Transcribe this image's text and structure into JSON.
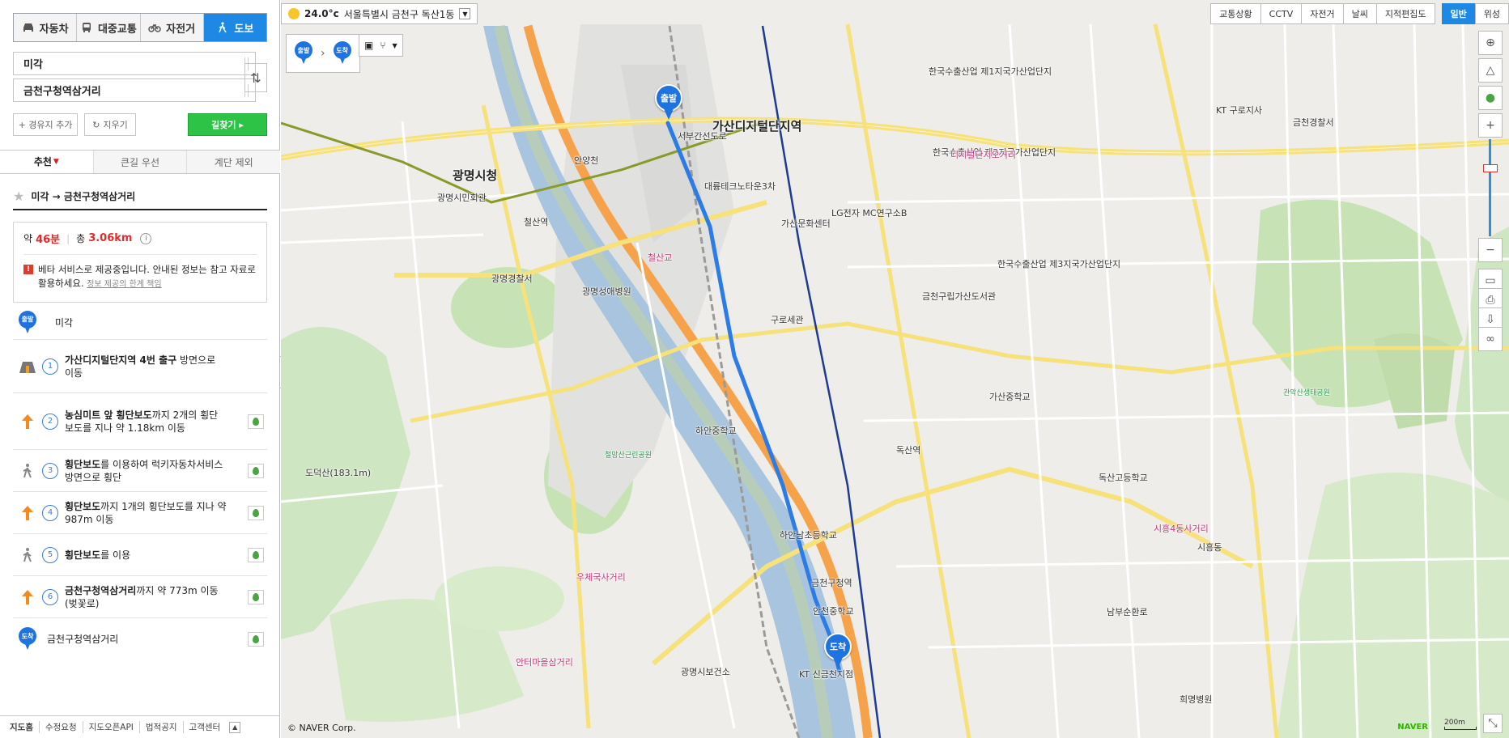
{
  "modes": [
    {
      "label": "자동차",
      "active": false
    },
    {
      "label": "대중교통",
      "active": false
    },
    {
      "label": "자전거",
      "active": false
    },
    {
      "label": "도보",
      "active": true
    }
  ],
  "origin_value": "미각",
  "destination_value": "금천구청역삼거리",
  "add_waypoint_label": "+ 경유지 추가",
  "clear_label": "지우기",
  "search_route_label": "길찾기 ▸",
  "tabs": [
    {
      "label": "추천",
      "active": true
    },
    {
      "label": "큰길 우선",
      "active": false
    },
    {
      "label": "계단 제외",
      "active": false
    }
  ],
  "route_title": "미각 → 금천구청역삼거리",
  "summary": {
    "approx": "약",
    "time": "46분",
    "total": "총",
    "distance": "3.06km",
    "info_icon": "i",
    "warning_icon": "!",
    "notice": "베타 서비스로 제공중입니다. 안내된 정보는 참고 자료로 활용하세요.",
    "notice_link": "정보 제공의 한계 책임"
  },
  "start_badge": "출발",
  "end_badge": "도착",
  "start_label": "미각",
  "end_label": "금천구청역삼거리",
  "steps": [
    {
      "num": "1",
      "bold": "가산디지털단지역 4번 출구",
      "rest": " 방면으로 이동",
      "icon": "subway-exit-icon",
      "has_pin": false
    },
    {
      "num": "2",
      "bold": "농심미트 앞 횡단보도",
      "rest": "까지 2개의 횡단보도를 지나 약 1.18km 이동",
      "icon": "straight-arrow-icon",
      "has_pin": true
    },
    {
      "num": "3",
      "bold": "횡단보도",
      "rest": "를 이용하여 럭키자동차서비스 방면으로 횡단",
      "icon": "pedestrian-icon",
      "has_pin": true
    },
    {
      "num": "4",
      "bold": "횡단보도",
      "rest": "까지 1개의 횡단보도를 지나 약 987m 이동",
      "icon": "straight-arrow-icon",
      "has_pin": true
    },
    {
      "num": "5",
      "bold": "횡단보도",
      "rest": "를 이용",
      "icon": "pedestrian-icon",
      "has_pin": true
    },
    {
      "num": "6",
      "bold": "금천구청역삼거리",
      "rest": "까지 약 773m 이동(벚꽃로)",
      "icon": "straight-arrow-icon",
      "has_pin": true
    }
  ],
  "footer": [
    "지도홈",
    "수정요청",
    "지도오픈API",
    "법적공지",
    "고객센터"
  ],
  "footer_up": "▲",
  "weather": {
    "temp": "24.0°c",
    "location": "서울특별시 금천구 독산1동"
  },
  "map_layers": [
    "교통상황",
    "CCTV",
    "자전거",
    "날씨",
    "지적편집도"
  ],
  "map_types": [
    {
      "label": "일반",
      "selected": true
    },
    {
      "label": "위성",
      "selected": false
    }
  ],
  "copyright": "© NAVER Corp.",
  "naver_logo": "NAVER",
  "scale_label": "200m",
  "map_labels": [
    {
      "text": "광명시청",
      "cls": "big"
    },
    {
      "text": "광명시민회관",
      "cls": ""
    },
    {
      "text": "철산역",
      "cls": ""
    },
    {
      "text": "가산디지털단지역",
      "cls": "big"
    },
    {
      "text": "한국수출산업 제1지국가산업단지",
      "cls": ""
    },
    {
      "text": "한국수출산업 제2지국가산업단지",
      "cls": ""
    },
    {
      "text": "한국수출산업 제3지국가산업단지",
      "cls": ""
    },
    {
      "text": "독산역",
      "cls": ""
    },
    {
      "text": "금천구청역",
      "cls": ""
    },
    {
      "text": "대륭테크노타운3차",
      "cls": ""
    },
    {
      "text": "가산문화센터",
      "cls": ""
    },
    {
      "text": "LG전자 MC연구소B",
      "cls": ""
    },
    {
      "text": "구로세관",
      "cls": ""
    },
    {
      "text": "금천구립가산도서관",
      "cls": ""
    },
    {
      "text": "가산중학교",
      "cls": ""
    },
    {
      "text": "독산고등학교",
      "cls": ""
    },
    {
      "text": "시흥동",
      "cls": ""
    },
    {
      "text": "관악산생태공원",
      "cls": "green"
    },
    {
      "text": "철망산근린공원",
      "cls": "green"
    },
    {
      "text": "광명성애병원",
      "cls": ""
    },
    {
      "text": "광명경찰서",
      "cls": ""
    },
    {
      "text": "하안중학교",
      "cls": ""
    },
    {
      "text": "우체국사거리",
      "cls": "pink"
    },
    {
      "text": "안터마을삼거리",
      "cls": "pink"
    },
    {
      "text": "시흥4동사거리",
      "cls": "pink"
    },
    {
      "text": "디지털단지오거리",
      "cls": "pink"
    },
    {
      "text": "철산교",
      "cls": "pink"
    },
    {
      "text": "금천경찰서",
      "cls": ""
    },
    {
      "text": "희명병원",
      "cls": ""
    },
    {
      "text": "도덕산(183.1m)",
      "cls": ""
    },
    {
      "text": "안천중학교",
      "cls": ""
    },
    {
      "text": "하안남초등학교",
      "cls": ""
    },
    {
      "text": "광명시보건소",
      "cls": ""
    },
    {
      "text": "KT 구로지사",
      "cls": ""
    },
    {
      "text": "KT 신금천지점",
      "cls": ""
    },
    {
      "text": "서부간선도로",
      "cls": ""
    },
    {
      "text": "안양천",
      "cls": ""
    },
    {
      "text": "남부순환로",
      "cls": ""
    }
  ]
}
